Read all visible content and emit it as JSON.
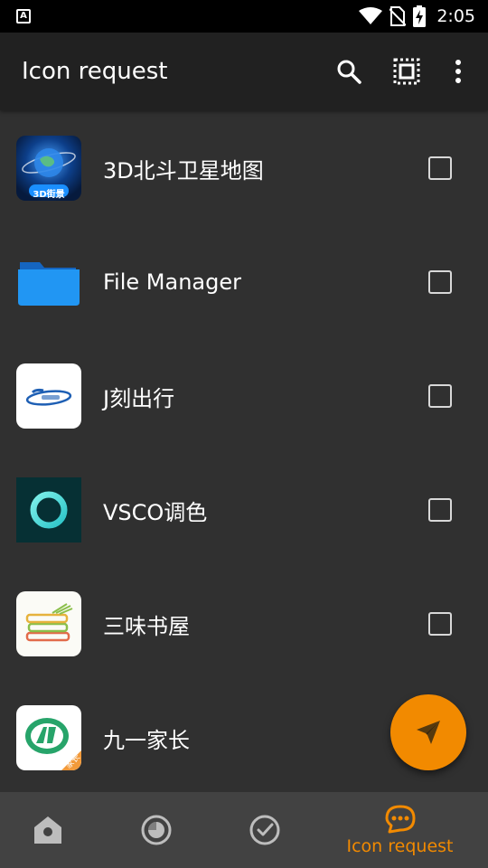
{
  "status_bar": {
    "time": "2:05",
    "notification_icon_letter": "A"
  },
  "app_bar": {
    "title": "Icon request",
    "actions": [
      "search-icon",
      "select-all-icon",
      "more-vert-icon"
    ]
  },
  "apps": [
    {
      "name": "3D北斗卫星地图",
      "icon_text": "3D街景",
      "checked": false
    },
    {
      "name": "File Manager",
      "checked": false
    },
    {
      "name": "J刻出行",
      "checked": false
    },
    {
      "name": "VSCO调色",
      "checked": false
    },
    {
      "name": "三味书屋",
      "checked": false
    },
    {
      "name": "九一家长",
      "icon_text": "家长",
      "checked": false
    }
  ],
  "fab": {
    "icon": "send-icon",
    "color": "#f28a00"
  },
  "bottom_nav": {
    "items": [
      {
        "icon": "home-icon"
      },
      {
        "icon": "theme-icon"
      },
      {
        "icon": "check-circle-icon"
      },
      {
        "icon": "icon-request-icon",
        "label": "Icon request",
        "active": true
      }
    ],
    "active_color": "#f28a00",
    "inactive_color": "#bdbdbd"
  }
}
